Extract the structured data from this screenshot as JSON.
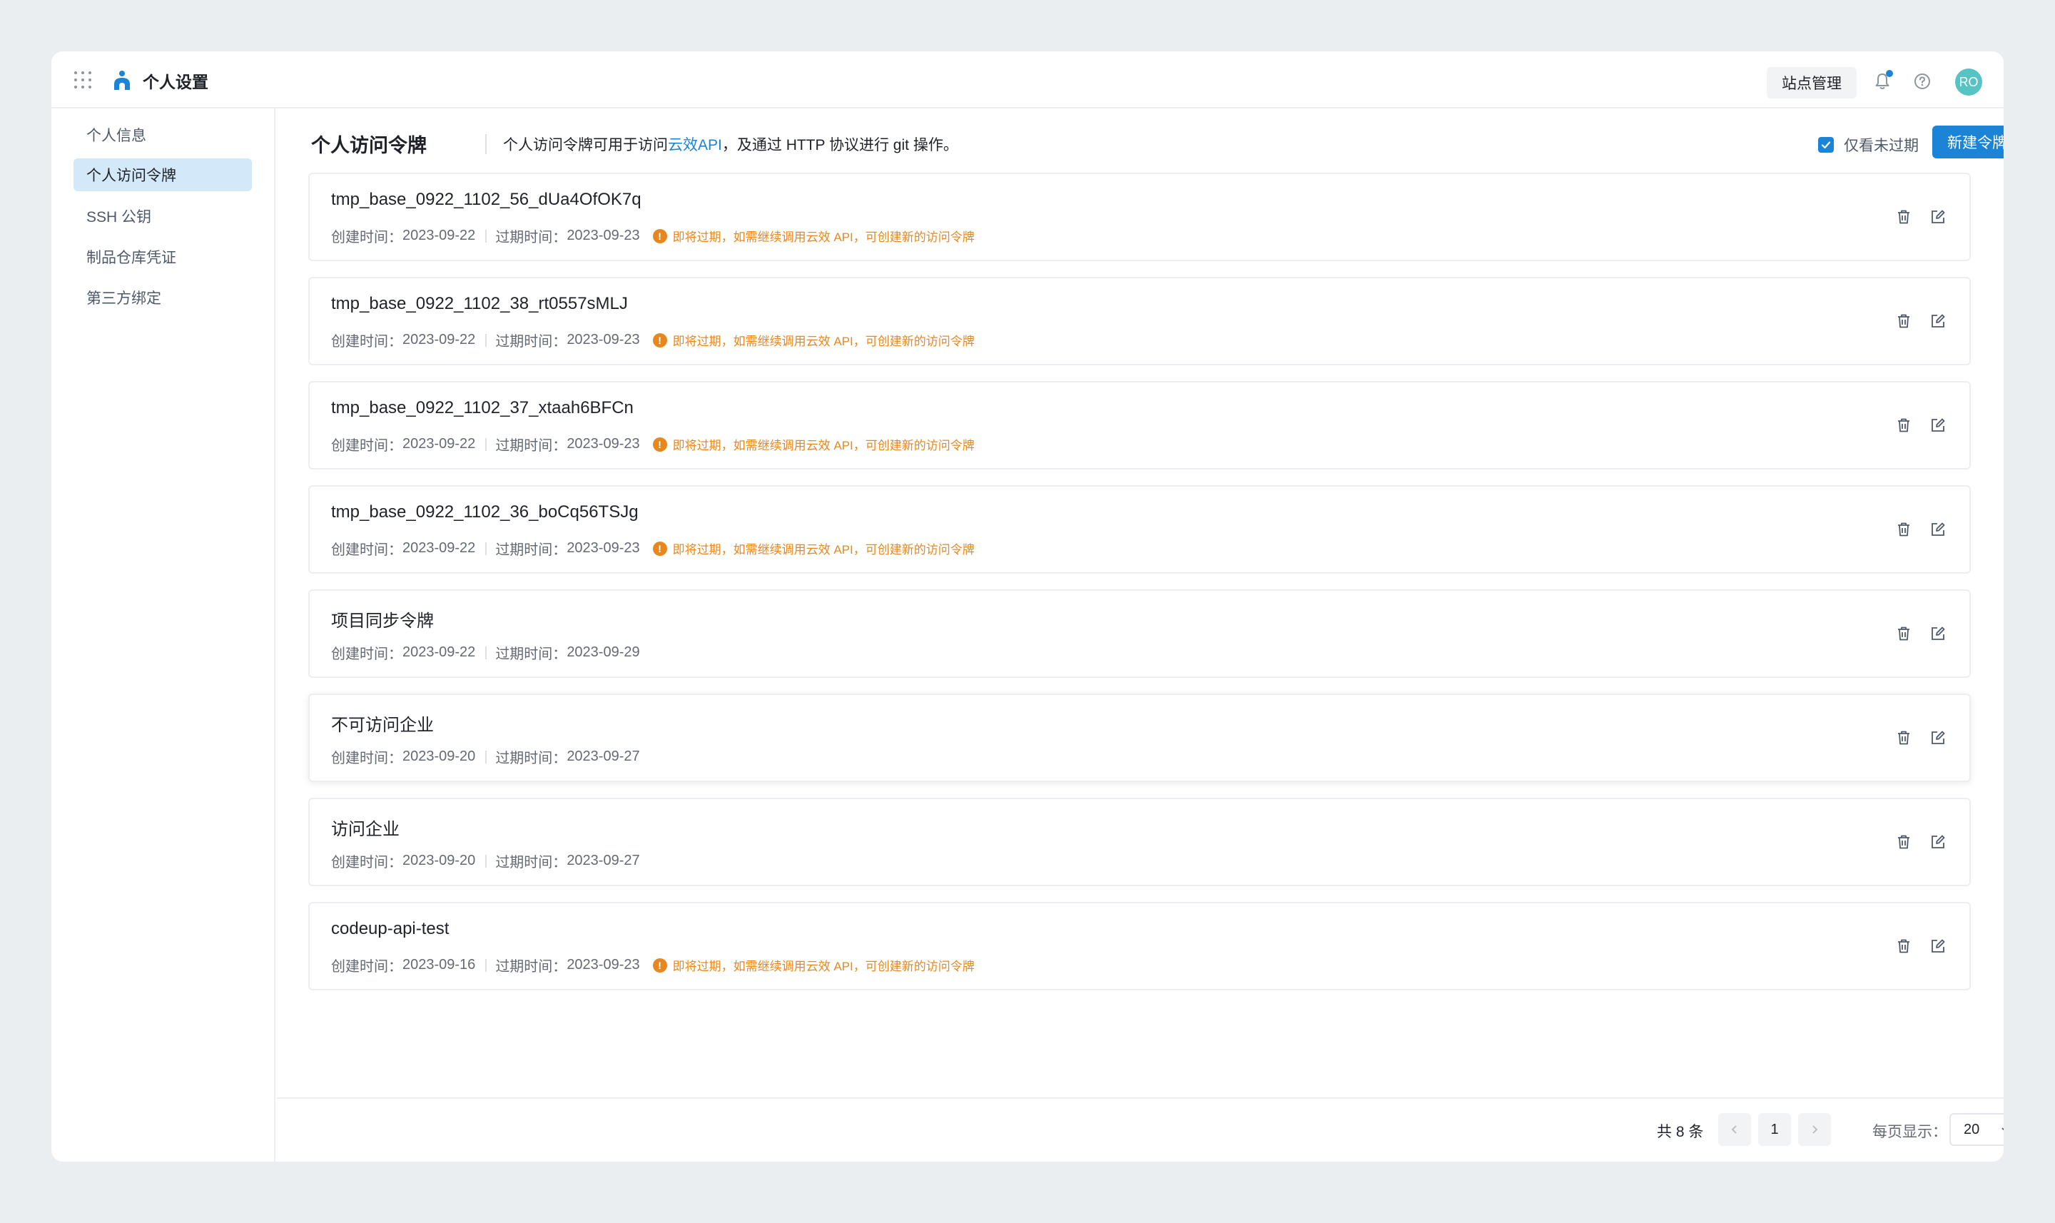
{
  "app": {
    "title": "个人设置",
    "site_manage_label": "站点管理",
    "avatar_initials": "RO",
    "brand_color": "#1b84d6"
  },
  "sidebar": {
    "items": [
      {
        "label": "个人信息",
        "active": false
      },
      {
        "label": "个人访问令牌",
        "active": true
      },
      {
        "label": "SSH 公钥",
        "active": false
      },
      {
        "label": "制品仓库凭证",
        "active": false
      },
      {
        "label": "第三方绑定",
        "active": false
      }
    ]
  },
  "main": {
    "title": "个人访问令牌",
    "desc_before": "个人访问令牌可用于访问",
    "desc_link": "云效API",
    "desc_after": "，及通过 HTTP 协议进行 git 操作。",
    "filter_label": "仅看未过期",
    "filter_checked": true,
    "new_button": "新建令牌"
  },
  "tokens": [
    {
      "name": "tmp_base_0922_1102_56_dUa4OfOK7q",
      "created_label": "创建时间：",
      "created": "2023-09-22",
      "expires_label": "过期时间：",
      "expires": "2023-09-23",
      "warning": "即将过期，如需继续调用云效 API，可创建新的访问令牌"
    },
    {
      "name": "tmp_base_0922_1102_38_rt0557sMLJ",
      "created_label": "创建时间：",
      "created": "2023-09-22",
      "expires_label": "过期时间：",
      "expires": "2023-09-23",
      "warning": "即将过期，如需继续调用云效 API，可创建新的访问令牌"
    },
    {
      "name": "tmp_base_0922_1102_37_xtaah6BFCn",
      "created_label": "创建时间：",
      "created": "2023-09-22",
      "expires_label": "过期时间：",
      "expires": "2023-09-23",
      "warning": "即将过期，如需继续调用云效 API，可创建新的访问令牌"
    },
    {
      "name": "tmp_base_0922_1102_36_boCq56TSJg",
      "created_label": "创建时间：",
      "created": "2023-09-22",
      "expires_label": "过期时间：",
      "expires": "2023-09-23",
      "warning": "即将过期，如需继续调用云效 API，可创建新的访问令牌"
    },
    {
      "name": "项目同步令牌",
      "created_label": "创建时间：",
      "created": "2023-09-22",
      "expires_label": "过期时间：",
      "expires": "2023-09-29",
      "warning": ""
    },
    {
      "name": "不可访问企业",
      "created_label": "创建时间：",
      "created": "2023-09-20",
      "expires_label": "过期时间：",
      "expires": "2023-09-27",
      "warning": ""
    },
    {
      "name": "访问企业",
      "created_label": "创建时间：",
      "created": "2023-09-20",
      "expires_label": "过期时间：",
      "expires": "2023-09-27",
      "warning": ""
    },
    {
      "name": "codeup-api-test",
      "created_label": "创建时间：",
      "created": "2023-09-16",
      "expires_label": "过期时间：",
      "expires": "2023-09-23",
      "warning": "即将过期，如需继续调用云效 API，可创建新的访问令牌"
    }
  ],
  "pagination": {
    "total_label": "共 8 条",
    "current_page": "1",
    "per_page_label": "每页显示：",
    "per_page_value": "20"
  },
  "colors": {
    "warning": "#e8871e",
    "active_nav_bg": "#d3e8f8",
    "page_bg": "#ebeef1"
  },
  "icons": {
    "apps": "apps-grid-icon",
    "logo": "yunxiao-logo-icon",
    "bell": "bell-icon",
    "help": "help-circle-icon",
    "check": "check-icon",
    "warning": "warning-circle-icon",
    "delete": "trash-icon",
    "edit": "edit-icon",
    "prev": "chevron-left-icon",
    "next": "chevron-right-icon",
    "dropdown": "chevron-down-icon"
  }
}
